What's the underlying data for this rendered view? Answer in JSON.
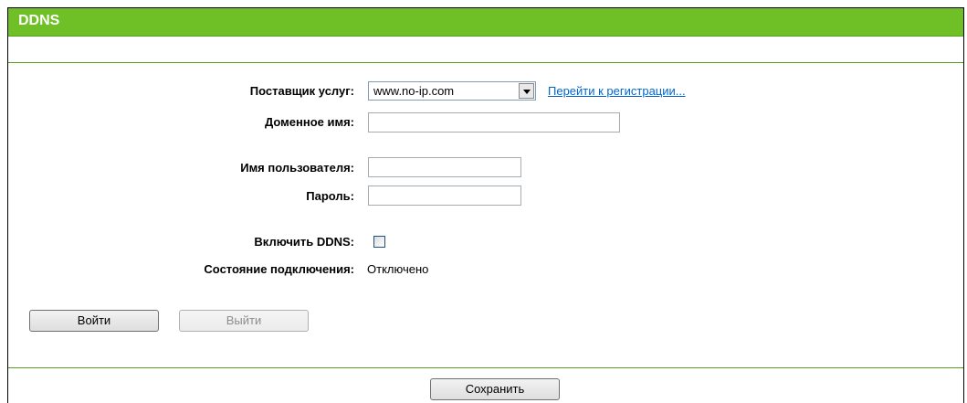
{
  "header": {
    "title": "DDNS"
  },
  "form": {
    "provider_label": "Поставщик услуг:",
    "provider_value": "www.no-ip.com",
    "register_link": "Перейти к регистрации...",
    "domain_label": "Доменное имя:",
    "domain_value": "",
    "username_label": "Имя пользователя:",
    "username_value": "",
    "password_label": "Пароль:",
    "password_value": "",
    "enable_label": "Включить DDNS:",
    "enable_checked": false,
    "status_label": "Состояние подключения:",
    "status_value": "Отключено"
  },
  "buttons": {
    "login": "Войти",
    "logout": "Выйти",
    "save": "Сохранить"
  },
  "colors": {
    "header_bg": "#6fbf26",
    "rule": "#5aa11a",
    "link": "#0066cc"
  }
}
